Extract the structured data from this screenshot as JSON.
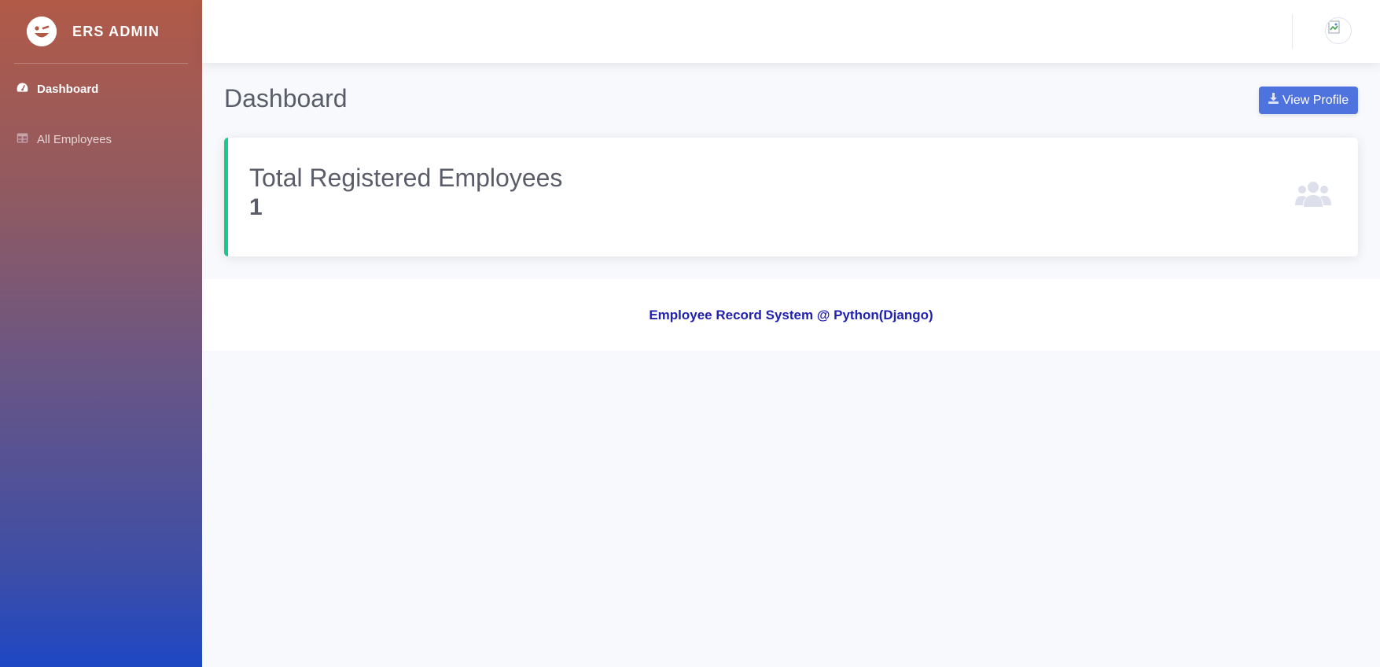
{
  "brand": {
    "title": "ERS ADMIN"
  },
  "sidebar": {
    "items": [
      {
        "label": "Dashboard",
        "icon": "tachometer-icon",
        "active": true
      },
      {
        "label": "All Employees",
        "icon": "table-icon",
        "active": false
      }
    ]
  },
  "topbar": {
    "avatar_icon": "broken-image-icon"
  },
  "main": {
    "title": "Dashboard",
    "view_profile_label": "View Profile",
    "view_profile_icon": "download-icon"
  },
  "stat_card": {
    "label": "Total Registered Employees",
    "value": "1",
    "icon": "users-icon",
    "accent_color": "#1cc88a"
  },
  "footer": {
    "text": "Employee Record System @ Python(Django)"
  },
  "colors": {
    "primary": "#4e73df",
    "text": "#5a5c69",
    "footer_text": "#1f1fb0",
    "sidebar_top": "#b15a48",
    "sidebar_bottom": "#1e47c4"
  }
}
